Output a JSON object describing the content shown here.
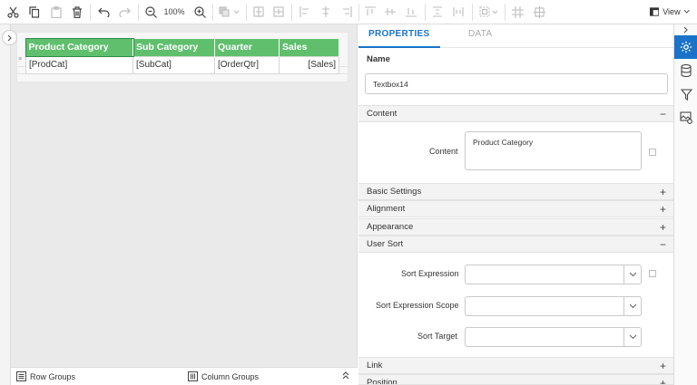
{
  "toolbar": {
    "zoom": "100%",
    "view_label": "View"
  },
  "table": {
    "headers": [
      "Product Category",
      "Sub Category",
      "Quarter",
      "Sales"
    ],
    "cells": [
      "[ProdCat]",
      "[SubCat]",
      "[OrderQtr]",
      "[Sales]"
    ]
  },
  "bottom": {
    "row_groups": "Row Groups",
    "column_groups": "Column Groups"
  },
  "tabs": {
    "properties": "PROPERTIES",
    "data": "DATA"
  },
  "properties": {
    "name_label": "Name",
    "name_value": "Textbox14",
    "content_section": "Content",
    "content_label": "Content",
    "content_value": "Product Category",
    "basic_settings": "Basic Settings",
    "alignment": "Alignment",
    "appearance": "Appearance",
    "user_sort": "User Sort",
    "sort_expression": "Sort Expression",
    "sort_expression_scope": "Sort Expression Scope",
    "sort_target": "Sort Target",
    "link": "Link",
    "position": "Position"
  },
  "colors": {
    "accent": "#1a73c8",
    "header_green": "#5fbf6d"
  }
}
